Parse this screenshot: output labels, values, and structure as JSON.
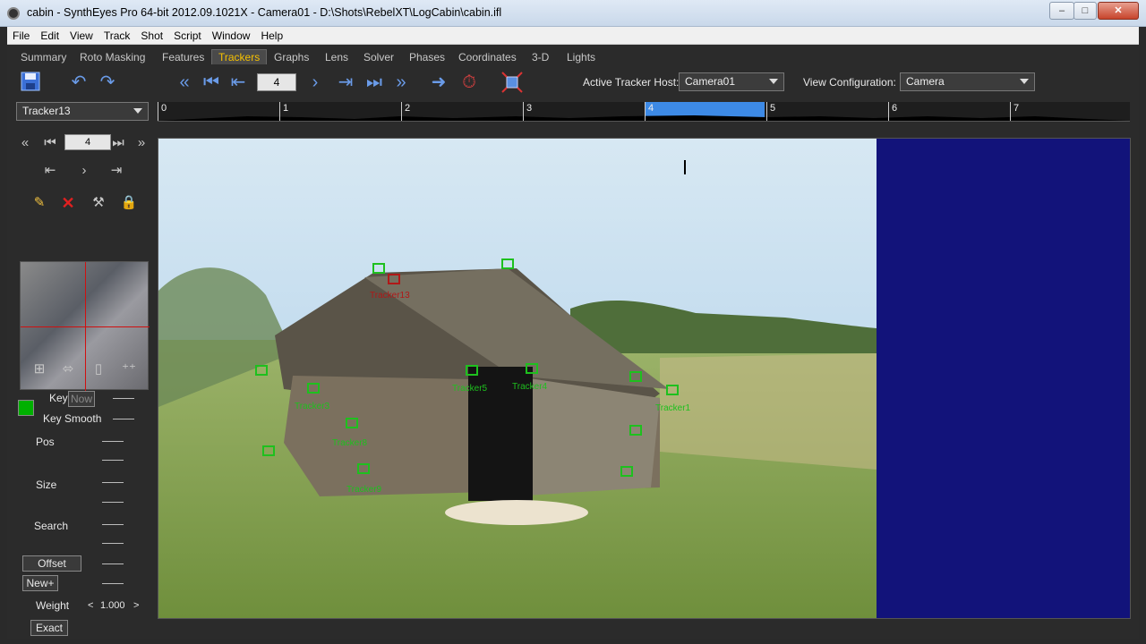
{
  "window": {
    "title": "cabin - SynthEyes Pro 64-bit 2012.09.1021X - Camera01 - D:\\Shots\\RebelXT\\LogCabin\\cabin.ifl",
    "minimize": "–",
    "maximize": "□",
    "close": "✕"
  },
  "menu": [
    "File",
    "Edit",
    "View",
    "Track",
    "Shot",
    "Script",
    "Window",
    "Help"
  ],
  "tabs": [
    "Summary",
    "Roto Masking",
    "Features",
    "Trackers",
    "Graphs",
    "Lens",
    "Solver",
    "Phases",
    "Coordinates",
    "3-D",
    "Lights"
  ],
  "active_tab": "Trackers",
  "toolbar": {
    "frame_value": "4",
    "active_tracker_host_label": "Active Tracker Host:",
    "active_tracker_host_value": "Camera01",
    "view_config_label": "View Configuration:",
    "view_config_value": "Camera"
  },
  "tracker_select": "Tracker13",
  "timeline_ticks": [
    "0",
    "1",
    "2",
    "3",
    "4",
    "5",
    "6",
    "7"
  ],
  "left_panel": {
    "frame_value": "4",
    "key_label": "Key",
    "now_label": "Now",
    "key_smooth_label": "Key Smooth",
    "pos_label": "Pos",
    "size_label": "Size",
    "search_label": "Search",
    "offset_label": "Offset",
    "new_label": "New+",
    "weight_label": "Weight",
    "weight_value": "1.000",
    "exact_label": "Exact",
    "swatch_color": "#00b000"
  },
  "trackers": [
    {
      "name": "Tracker13",
      "selected": true
    },
    {
      "name": "Tracker1"
    },
    {
      "name": "Tracker3"
    },
    {
      "name": "Tracker4"
    },
    {
      "name": "Tracker5"
    },
    {
      "name": "Tracker8"
    },
    {
      "name": "Tracker9"
    }
  ]
}
